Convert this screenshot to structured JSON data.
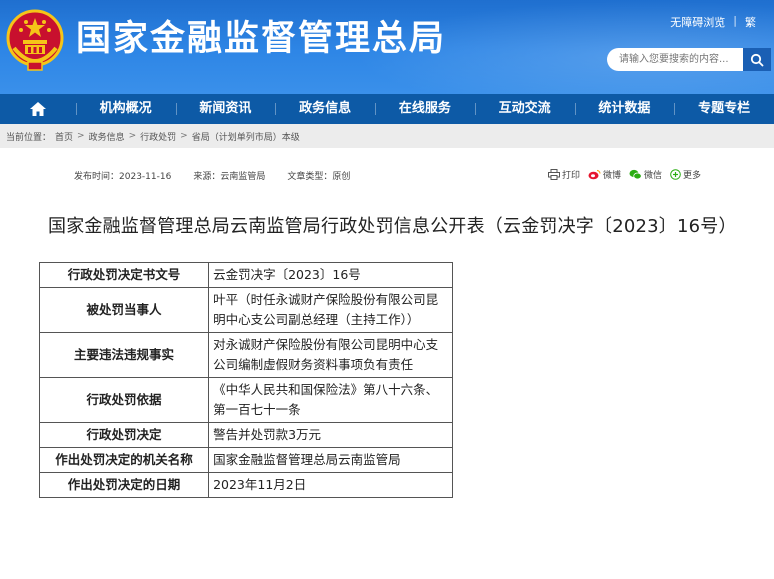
{
  "header": {
    "site_title": "国家金融监督管理总局",
    "top_links": [
      "无障碍浏览",
      "繁"
    ],
    "search_placeholder": "请输入您要搜索的内容...",
    "emblem_icon": "national-emblem-icon",
    "colors": {
      "header_blue": "#2e86e6",
      "nav_blue": "#0d5aa6"
    }
  },
  "nav": {
    "home_icon": "home-icon",
    "items": [
      "机构概况",
      "新闻资讯",
      "政务信息",
      "在线服务",
      "互动交流",
      "统计数据",
      "专题专栏"
    ]
  },
  "breadcrumb": {
    "prefix": "当前位置：",
    "items": [
      "首页",
      "政务信息",
      "行政处罚",
      "省局（计划单列市局）本级"
    ],
    "separator": ">"
  },
  "meta": {
    "date_label": "发布时间：",
    "date": "2023-11-16",
    "source_label": "来源：",
    "source": "云南监管局",
    "type_label": "文章类型：",
    "type": "原创"
  },
  "share": [
    "打印",
    "微博",
    "微信",
    "更多"
  ],
  "article": {
    "title": "国家金融监督管理总局云南监管局行政处罚信息公开表（云金罚决字〔2023〕16号）"
  },
  "table": {
    "rows": [
      {
        "key": "行政处罚决定书文号",
        "value": "云金罚决字〔2023〕16号"
      },
      {
        "key": "被处罚当事人",
        "value": "叶平（时任永诚财产保险股份有限公司昆明中心支公司副总经理（主持工作））"
      },
      {
        "key": "主要违法违规事实",
        "value": "对永诚财产保险股份有限公司昆明中心支公司编制虚假财务资料事项负有责任"
      },
      {
        "key": "行政处罚依据",
        "value": "《中华人民共和国保险法》第八十六条、第一百七十一条"
      },
      {
        "key": "行政处罚决定",
        "value": "警告并处罚款3万元"
      },
      {
        "key": "作出处罚决定的机关名称",
        "value": "国家金融监督管理总局云南监管局"
      },
      {
        "key": "作出处罚决定的日期",
        "value": "2023年11月2日"
      }
    ]
  }
}
